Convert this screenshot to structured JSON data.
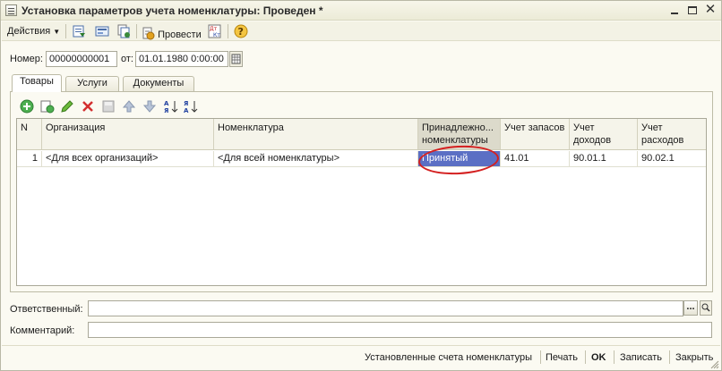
{
  "window": {
    "title": "Установка параметров учета номенклатуры: Проведен *",
    "buttons": [
      "minimize",
      "maximize",
      "close"
    ]
  },
  "toolbar": {
    "actions_label": "Действия",
    "post_label": "Провести",
    "icons": [
      "post-and-close-icon",
      "view-icon",
      "copy-icon",
      "post-icon",
      "dt-kt-icon",
      "help-icon"
    ]
  },
  "header": {
    "number_label": "Номер:",
    "number_value": "00000000001",
    "date_label": "от:",
    "date_value": "01.01.1980 0:00:00"
  },
  "tabs": [
    {
      "label": "Товары",
      "active": true
    },
    {
      "label": "Услуги",
      "active": false
    },
    {
      "label": "Документы",
      "active": false
    }
  ],
  "grid_toolbar": {
    "icons": [
      "add-icon",
      "copy-row-icon",
      "edit-icon",
      "delete-icon",
      "finish-edit-icon",
      "move-up-icon",
      "move-down-icon",
      "sort-asc-icon",
      "sort-desc-icon"
    ]
  },
  "grid": {
    "columns": [
      {
        "label": "N"
      },
      {
        "label": "Организация"
      },
      {
        "label": "Номенклатура"
      },
      {
        "label": "Принадлежно... номенклатуры"
      },
      {
        "label": "Учет запасов"
      },
      {
        "label": "Учет доходов"
      },
      {
        "label": "Учет расходов"
      }
    ],
    "rows": [
      {
        "n": "1",
        "organization": "<Для всех организаций>",
        "nomenclature": "<Для всей номенклатуры>",
        "ownership": "Принятый",
        "stock": "41.01",
        "income": "90.01.1",
        "expense": "90.02.1"
      }
    ],
    "selected_cell": "ownership",
    "highlight_color": "#5b6fc4",
    "annotation_color": "#d42020"
  },
  "bottom": {
    "responsible_label": "Ответственный:",
    "responsible_value": "",
    "responsible_button": "...",
    "comment_label": "Комментарий:",
    "comment_value": ""
  },
  "footer": {
    "accounts_label": "Установленные счета номенклатуры",
    "print_label": "Печать",
    "ok_label": "OK",
    "save_label": "Записать",
    "close_label": "Закрыть"
  }
}
